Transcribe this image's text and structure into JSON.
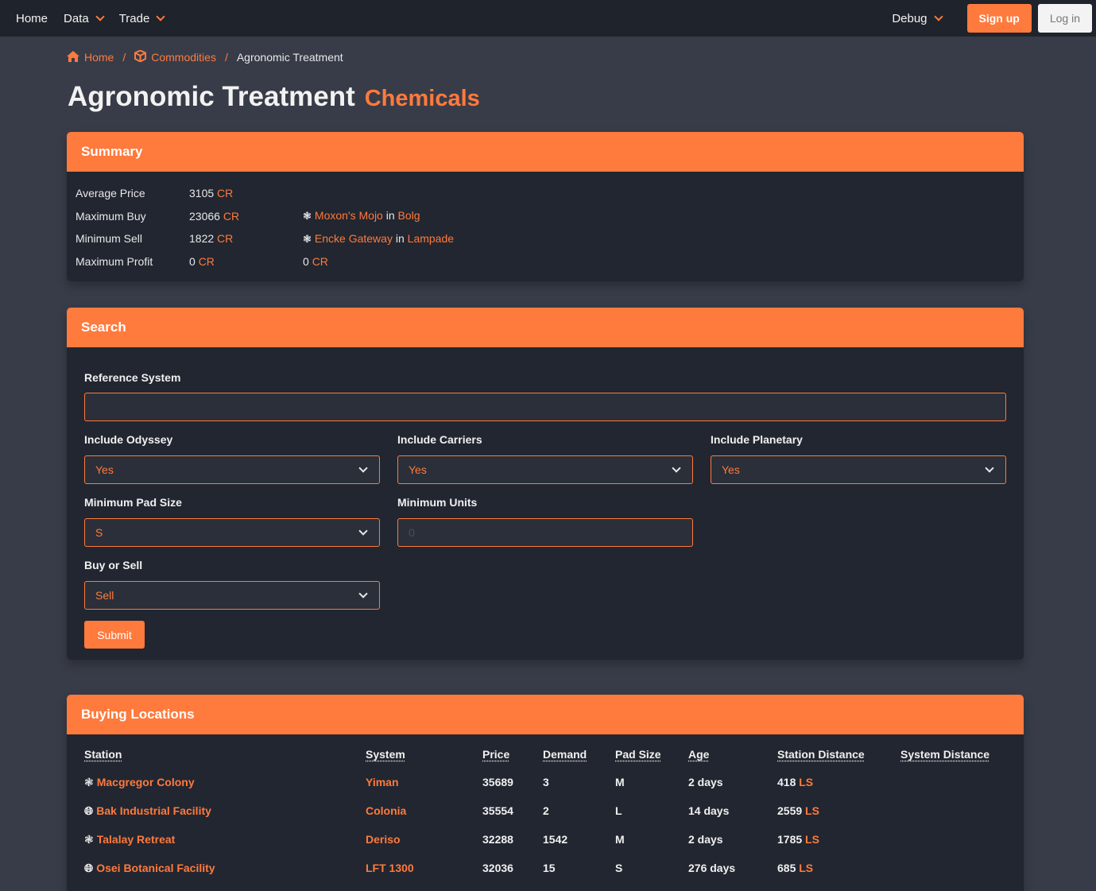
{
  "nav": {
    "home": "Home",
    "data": "Data",
    "trade": "Trade",
    "debug": "Debug",
    "signup": "Sign up",
    "login": "Log in"
  },
  "breadcrumb": {
    "home": "Home",
    "commodities": "Commodities",
    "current": "Agronomic Treatment",
    "sep": "/"
  },
  "title": {
    "name": "Agronomic Treatment",
    "category": "Chemicals"
  },
  "summary": {
    "header": "Summary",
    "unit": "CR",
    "in": "in",
    "rows": [
      {
        "label": "Average Price",
        "value": "3105",
        "station": "",
        "system": "",
        "extra": ""
      },
      {
        "label": "Maximum Buy",
        "value": "23066",
        "station": "Moxon's Mojo",
        "system": "Bolg",
        "extra": ""
      },
      {
        "label": "Minimum Sell",
        "value": "1822",
        "station": "Encke Gateway",
        "system": "Lampade",
        "extra": ""
      },
      {
        "label": "Maximum Profit",
        "value": "0",
        "station": "",
        "system": "",
        "extra": "0"
      }
    ]
  },
  "search": {
    "header": "Search",
    "reference_label": "Reference System",
    "reference_value": "",
    "odyssey_label": "Include Odyssey",
    "odyssey_value": "Yes",
    "carriers_label": "Include Carriers",
    "carriers_value": "Yes",
    "planetary_label": "Include Planetary",
    "planetary_value": "Yes",
    "pad_label": "Minimum Pad Size",
    "pad_value": "S",
    "units_label": "Minimum Units",
    "units_placeholder": "0",
    "buysell_label": "Buy or Sell",
    "buysell_value": "Sell",
    "submit": "Submit"
  },
  "buying": {
    "header": "Buying Locations",
    "columns": [
      "Station",
      "System",
      "Price",
      "Demand",
      "Pad Size",
      "Age",
      "Station Distance",
      "System Distance"
    ],
    "ls": "LS",
    "rows": [
      {
        "icon": "gear-icon",
        "station": "Macgregor Colony",
        "system": "Yiman",
        "price": "35689",
        "demand": "3",
        "pad": "M",
        "age": "2 days",
        "dist": "418"
      },
      {
        "icon": "globe-icon",
        "station": "Bak Industrial Facility",
        "system": "Colonia",
        "price": "35554",
        "demand": "2",
        "pad": "L",
        "age": "14 days",
        "dist": "2559"
      },
      {
        "icon": "gear-icon",
        "station": "Talalay Retreat",
        "system": "Deriso",
        "price": "32288",
        "demand": "1542",
        "pad": "M",
        "age": "2 days",
        "dist": "1785"
      },
      {
        "icon": "globe-icon",
        "station": "Osei Botanical Facility",
        "system": "LFT 1300",
        "price": "32036",
        "demand": "15",
        "pad": "S",
        "age": "276 days",
        "dist": "685"
      }
    ]
  }
}
